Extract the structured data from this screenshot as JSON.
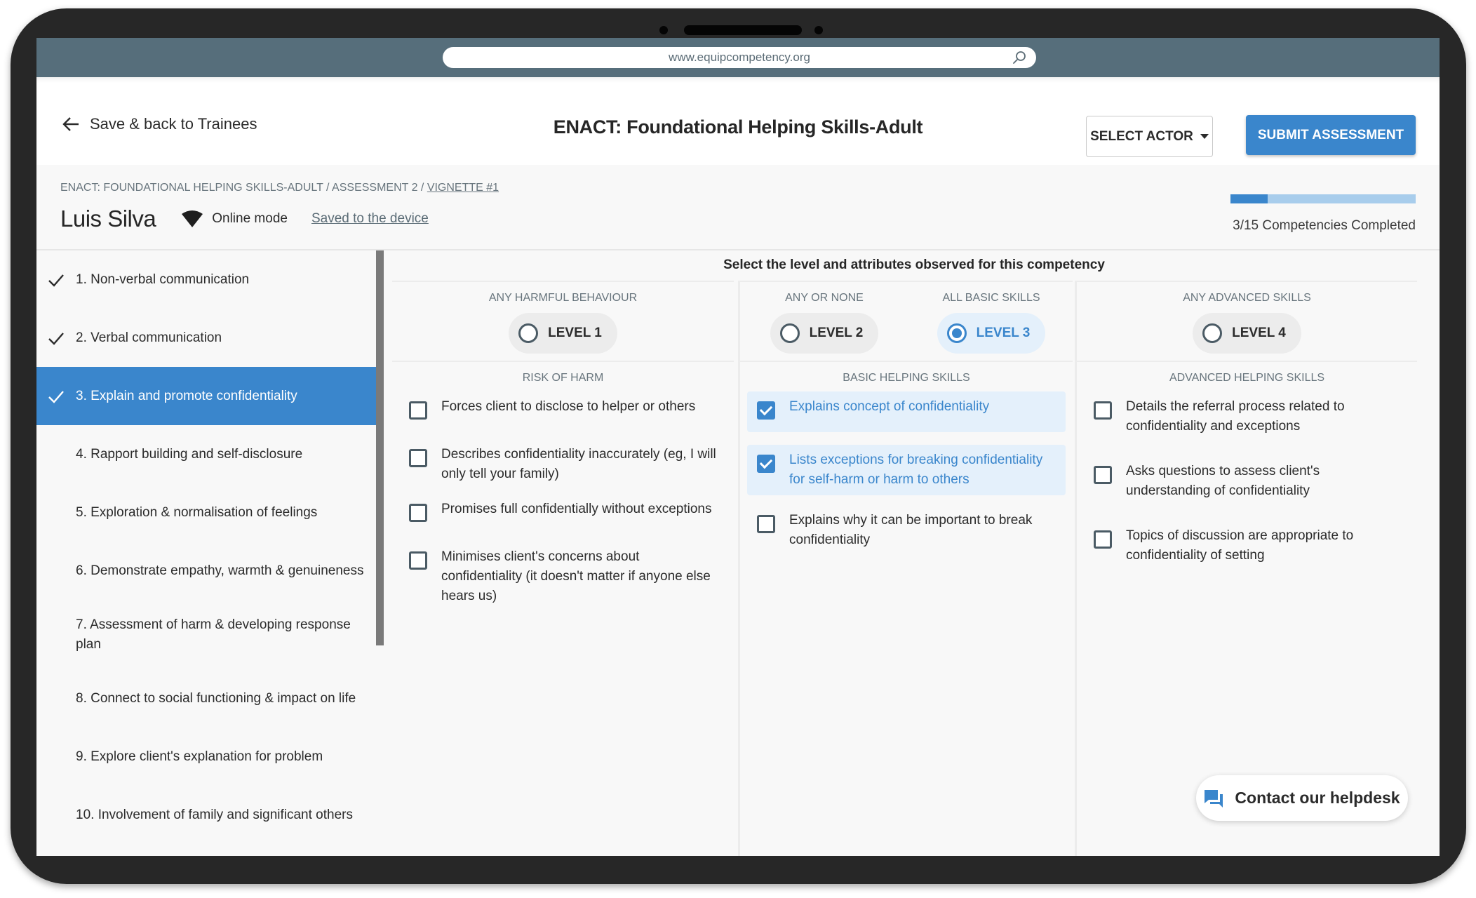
{
  "browser": {
    "url": "www.equipcompetency.org"
  },
  "header": {
    "back_label": "Save & back to Trainees",
    "title": "ENACT: Foundational Helping Skills-Adult",
    "select_actor_label": "SELECT ACTOR",
    "submit_label": "SUBMIT ASSESSMENT"
  },
  "info": {
    "breadcrumb": {
      "path": "ENACT: FOUNDATIONAL HELPING SKILLS-ADULT / ASSESSMENT 2 / ",
      "current": "VIGNETTE #1"
    },
    "trainee_name": "Luis Silva",
    "mode": "Online mode",
    "saved_status": "Saved to the device",
    "progress": {
      "completed": 3,
      "total": 15,
      "fraction": 0.2,
      "label": "3/15 Competencies Completed"
    }
  },
  "sidebar": {
    "items": [
      {
        "label": "1. Non-verbal communication",
        "completed": true,
        "active": false
      },
      {
        "label": "2. Verbal communication",
        "completed": true,
        "active": false
      },
      {
        "label": "3. Explain and promote confidentiality",
        "completed": true,
        "active": true
      },
      {
        "label": "4. Rapport building and self-disclosure",
        "completed": false,
        "active": false
      },
      {
        "label": "5. Exploration & normalisation of feelings",
        "completed": false,
        "active": false
      },
      {
        "label": "6. Demonstrate empathy, warmth & genuineness",
        "completed": false,
        "active": false
      },
      {
        "label": "7. Assessment of harm & developing response plan",
        "completed": false,
        "active": false
      },
      {
        "label": "8. Connect to social functioning & impact on life",
        "completed": false,
        "active": false
      },
      {
        "label": "9. Explore client's explanation for problem",
        "completed": false,
        "active": false
      },
      {
        "label": "10. Involvement of family and significant others",
        "completed": false,
        "active": false
      }
    ]
  },
  "main": {
    "instruction": "Select the level and attributes observed for this competency",
    "levels": [
      {
        "caption": "ANY HARMFUL BEHAVIOUR",
        "label": "LEVEL 1",
        "selected": false
      },
      {
        "caption": "ANY OR NONE",
        "label": "LEVEL 2",
        "selected": false
      },
      {
        "caption": "ALL BASIC SKILLS",
        "label": "LEVEL 3",
        "selected": true
      },
      {
        "caption": "ANY ADVANCED SKILLS",
        "label": "LEVEL 4",
        "selected": false
      }
    ],
    "sections": [
      {
        "caption": "RISK OF HARM",
        "items": [
          {
            "text": "Forces client to disclose to helper or others",
            "checked": false
          },
          {
            "text": "Describes confidentiality inaccurately (eg, I will only tell your family)",
            "checked": false
          },
          {
            "text": "Promises full confidentially without exceptions",
            "checked": false
          },
          {
            "text": "Minimises client's concerns about confidentiality (it doesn't matter if anyone else hears us)",
            "checked": false
          }
        ]
      },
      {
        "caption": "BASIC HELPING SKILLS",
        "items": [
          {
            "text": "Explains concept of confidentiality",
            "checked": true
          },
          {
            "text": "Lists exceptions for breaking confidentiality for self-harm or harm to others",
            "checked": true
          },
          {
            "text": "Explains why it can be important to break confidentiality",
            "checked": false
          }
        ]
      },
      {
        "caption": "ADVANCED HELPING SKILLS",
        "items": [
          {
            "text": "Details the referral process related to confidentiality and exceptions",
            "checked": false
          },
          {
            "text": "Asks questions to assess client's understanding of confidentiality",
            "checked": false
          },
          {
            "text": "Topics of discussion are appropriate to confidentiality of setting",
            "checked": false
          }
        ]
      }
    ]
  },
  "helpdesk": {
    "label": "Contact our helpdesk"
  },
  "colors": {
    "accent": "#3a86cc",
    "accent_light": "#e4f0fb",
    "progress_track": "#a8cdec",
    "url_band": "#566e7b",
    "bezel": "#272727"
  }
}
